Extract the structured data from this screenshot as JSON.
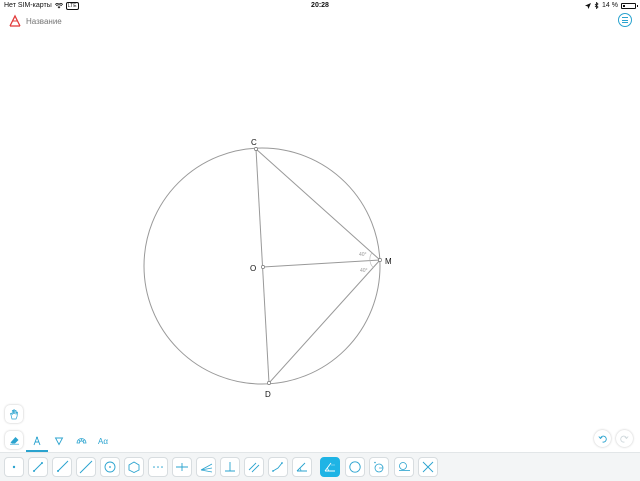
{
  "status_bar": {
    "carrier": "Нет SIM-карты",
    "network_badge": "LTE",
    "time": "20:28",
    "battery_text": "14 %",
    "battery_level": 0.14
  },
  "header": {
    "title_placeholder": "Название"
  },
  "construction": {
    "points": {
      "C": {
        "label": "C"
      },
      "O": {
        "label": "O"
      },
      "M": {
        "label": "M"
      },
      "D": {
        "label": "D"
      }
    },
    "angles": [
      "40°",
      "40°"
    ]
  },
  "mode_tabs": {
    "text_tab_label": "Aα"
  },
  "colors": {
    "accent": "#1fb4e5",
    "figure_stroke": "#999999",
    "status_text": "#111111"
  },
  "icons": {
    "tools": [
      "point-icon",
      "segment-icon",
      "ray-icon",
      "line-icon",
      "circle-center-icon",
      "polygon-icon",
      "dotted-points-icon",
      "midpoint-icon",
      "angle-bisector-icon",
      "perpendicular-icon",
      "parallel-icon",
      "broken-line-icon",
      "angle-icon",
      "measure-angle-icon",
      "circle-icon",
      "compass-icon",
      "tangent-icon",
      "intersection-icon"
    ]
  }
}
